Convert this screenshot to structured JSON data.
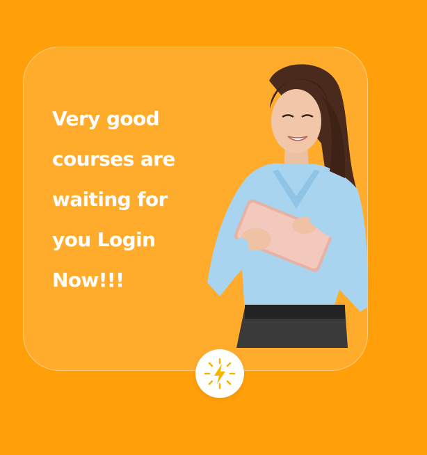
{
  "promo": {
    "headline_lines": [
      "Very good",
      "courses are",
      "waiting for",
      "you Login",
      "Now!!!"
    ]
  },
  "colors": {
    "background": "#FF9F0A",
    "card_fill": "rgba(255,255,255,0.14)",
    "text": "#FFFFFF",
    "badge_icon": "#F7B500"
  },
  "icons": {
    "badge": "lightning-bolt-icon"
  }
}
